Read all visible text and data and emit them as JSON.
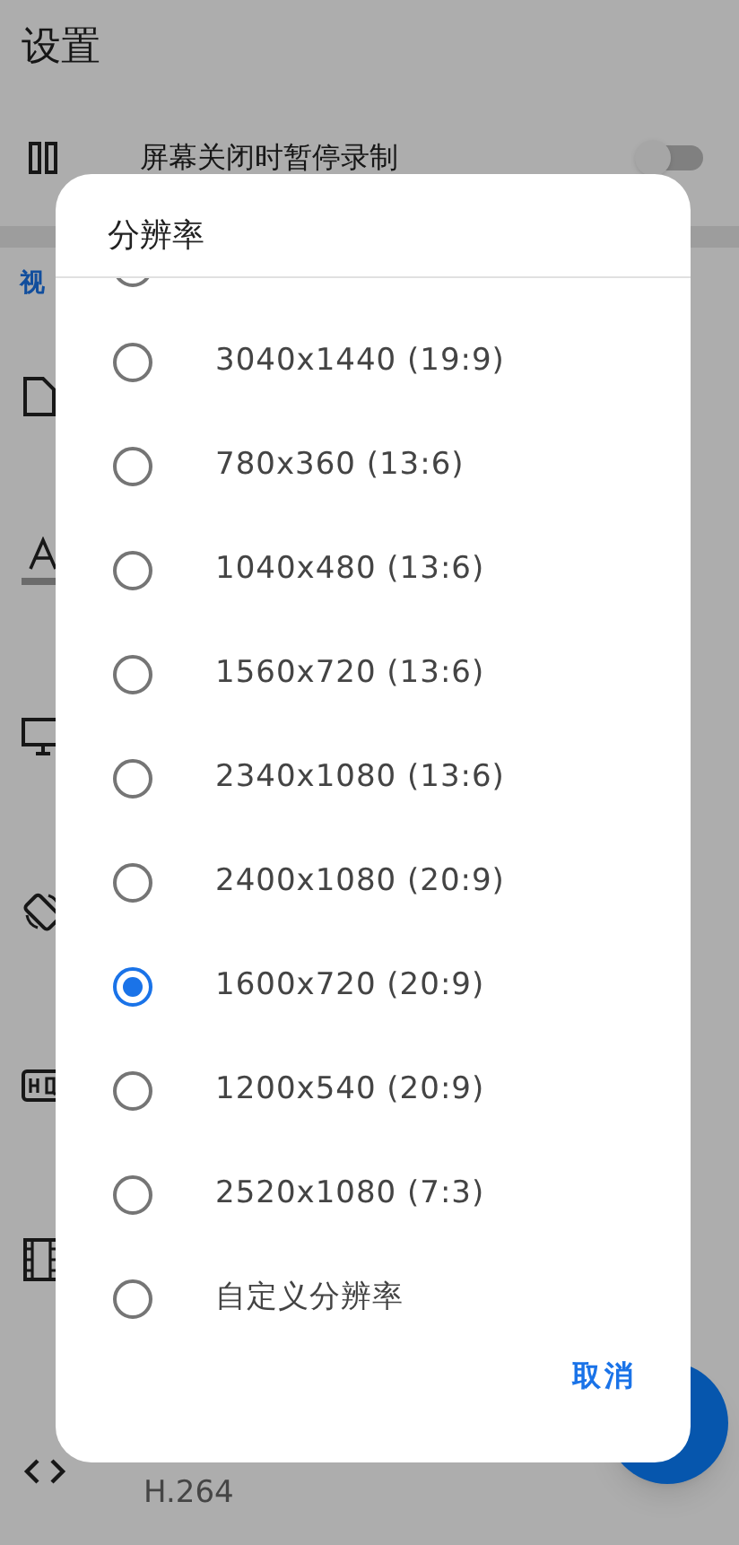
{
  "background": {
    "title": "设置",
    "pause_row": {
      "label": "屏幕关闭时暂停录制",
      "toggle_on": false
    },
    "section_header": "视",
    "codec_row": {
      "value": "H.264"
    }
  },
  "dialog": {
    "title": "分辨率",
    "options": [
      {
        "label": "3040x1440 (19:9)",
        "selected": false
      },
      {
        "label": "780x360 (13:6)",
        "selected": false
      },
      {
        "label": "1040x480 (13:6)",
        "selected": false
      },
      {
        "label": "1560x720 (13:6)",
        "selected": false
      },
      {
        "label": "2340x1080 (13:6)",
        "selected": false
      },
      {
        "label": "2400x1080 (20:9)",
        "selected": false
      },
      {
        "label": "1600x720 (20:9)",
        "selected": true
      },
      {
        "label": "1200x540 (20:9)",
        "selected": false
      },
      {
        "label": "2520x1080 (7:3)",
        "selected": false
      },
      {
        "label": "自定义分辨率",
        "selected": false
      }
    ],
    "cancel": "取消"
  }
}
